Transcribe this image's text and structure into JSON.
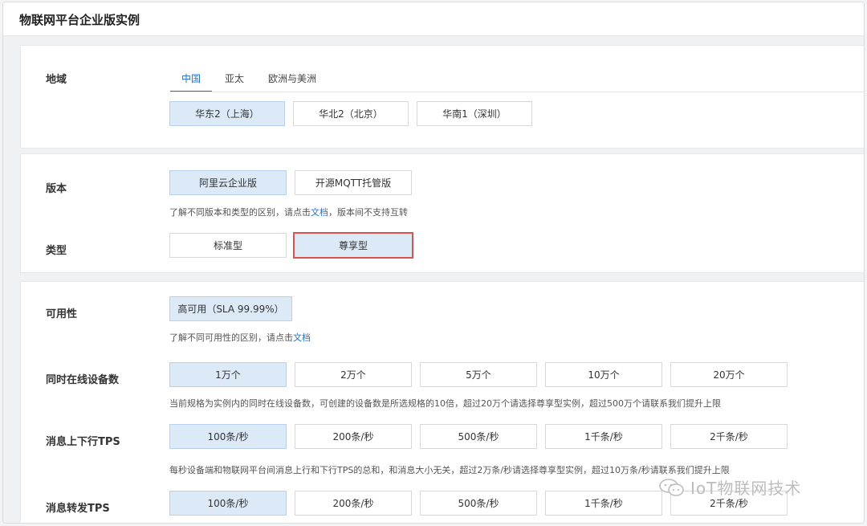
{
  "title": "物联网平台企业版实例",
  "region": {
    "label": "地域",
    "tabs": [
      "中国",
      "亚太",
      "欧洲与美洲"
    ],
    "options": [
      "华东2（上海）",
      "华北2（北京）",
      "华南1（深圳）"
    ]
  },
  "edition": {
    "label": "版本",
    "options": [
      "阿里云企业版",
      "开源MQTT托管版"
    ],
    "hint_prefix": "了解不同版本和类型的区别，请点击",
    "hint_link": "文档",
    "hint_suffix": "，版本间不支持互转"
  },
  "type": {
    "label": "类型",
    "options": [
      "标准型",
      "尊享型"
    ]
  },
  "availability": {
    "label": "可用性",
    "options": [
      "高可用（SLA 99.99%）"
    ],
    "hint_prefix": "了解不同可用性的区别，请点击",
    "hint_link": "文档"
  },
  "devices": {
    "label": "同时在线设备数",
    "options": [
      "1万个",
      "2万个",
      "5万个",
      "10万个",
      "20万个"
    ],
    "hint": "当前规格为实例内的同时在线设备数，可创建的设备数是所选规格的10倍，超过20万个请选择尊享型实例，超过500万个请联系我们提升上限"
  },
  "msg_tps": {
    "label": "消息上下行TPS",
    "options": [
      "100条/秒",
      "200条/秒",
      "500条/秒",
      "1千条/秒",
      "2千条/秒"
    ],
    "hint": "每秒设备端和物联网平台间消息上行和下行TPS的总和，和消息大小无关，超过2万条/秒请选择尊享型实例，超过10万条/秒请联系我们提升上限"
  },
  "forward_tps": {
    "label": "消息转发TPS",
    "options": [
      "100条/秒",
      "200条/秒",
      "500条/秒",
      "1千条/秒",
      "2千条/秒"
    ]
  },
  "watermark": "IoT物联网技术"
}
